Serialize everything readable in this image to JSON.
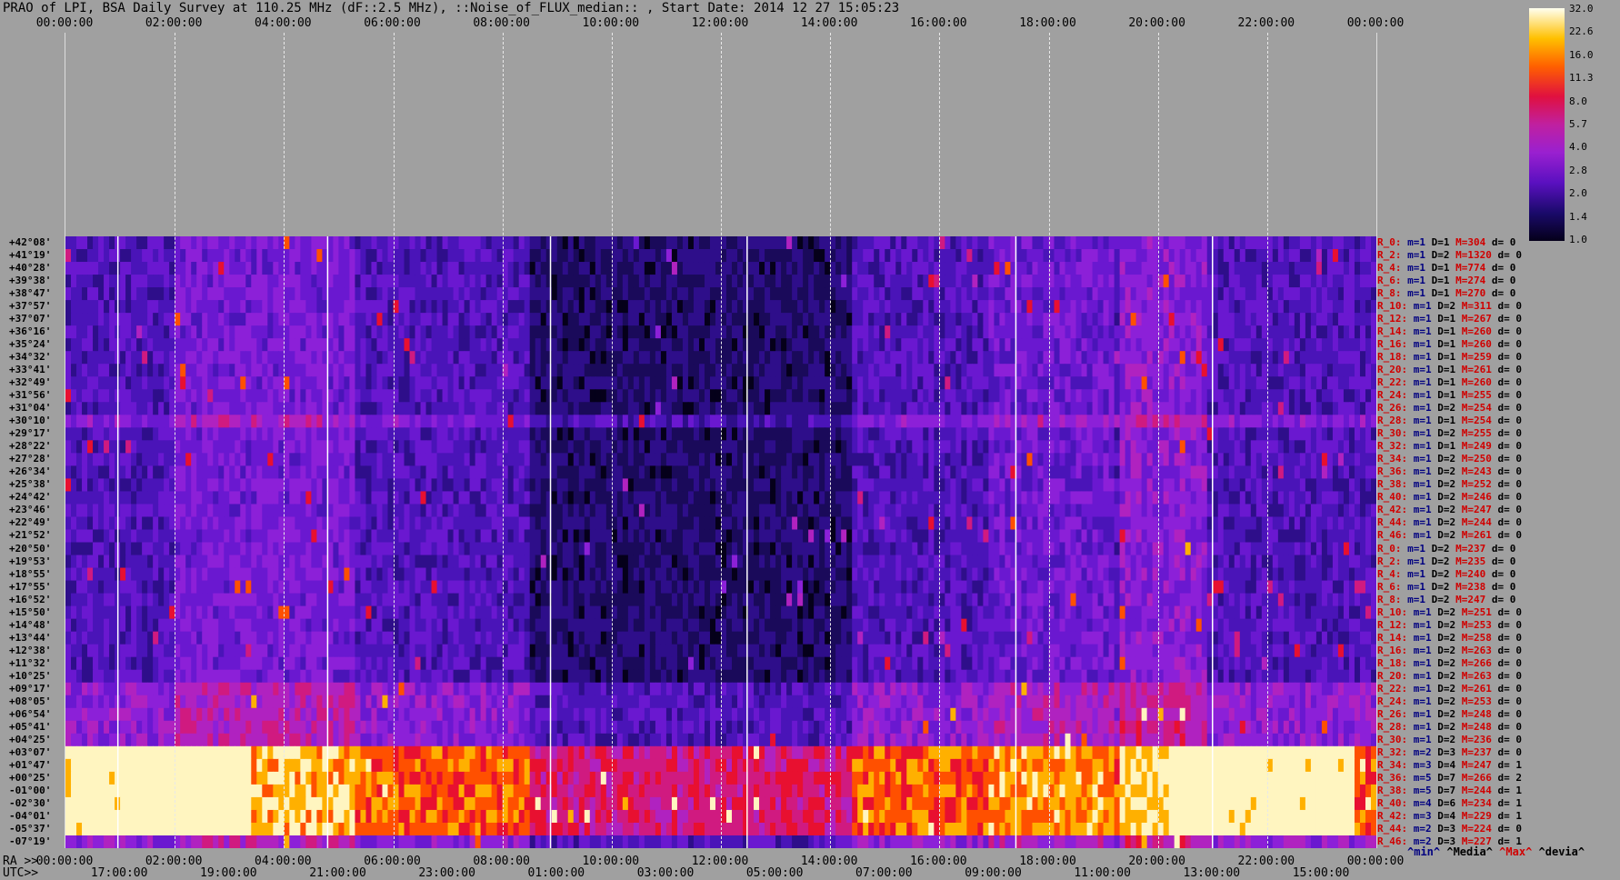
{
  "title": "PRAO of LPI, BSA Daily Survey at 110.25 MHz (dF::2.5 MHz), ::Noise_of_FLUX_median:: , Start Date: 2014 12 27 15:05:23",
  "top_ticks": [
    "00:00:00",
    "02:00:00",
    "04:00:00",
    "06:00:00",
    "08:00:00",
    "10:00:00",
    "12:00:00",
    "14:00:00",
    "16:00:00",
    "18:00:00",
    "20:00:00",
    "22:00:00",
    "00:00:00"
  ],
  "bottom_ra_prefix": "RA >>",
  "bottom_ra_ticks": [
    "00:00:00",
    "02:00:00",
    "04:00:00",
    "06:00:00",
    "08:00:00",
    "10:00:00",
    "12:00:00",
    "14:00:00",
    "16:00:00",
    "18:00:00",
    "20:00:00",
    "22:00:00",
    "00:00:00"
  ],
  "bottom_utc_prefix": "UTC>>",
  "bottom_utc_ticks": [
    "17:00:00",
    "19:00:00",
    "21:00:00",
    "23:00:00",
    "01:00:00",
    "03:00:00",
    "05:00:00",
    "07:00:00",
    "09:00:00",
    "11:00:00",
    "13:00:00",
    "15:00:00"
  ],
  "colorbar": {
    "labels": [
      "32.0",
      "22.6",
      "16.0",
      "11.3",
      "8.0",
      "5.7",
      "4.0",
      "2.8",
      "2.0",
      "1.4",
      "1.0"
    ]
  },
  "legend": {
    "min": "^min^",
    "median": "^Media^",
    "max": "^Max^",
    "devia": "^devia^"
  },
  "declinations": [
    "+42°08'",
    "+41°19'",
    "+40°28'",
    "+39°38'",
    "+38°47'",
    "+37°57'",
    "+37°07'",
    "+36°16'",
    "+35°24'",
    "+34°32'",
    "+33°41'",
    "+32°49'",
    "+31°56'",
    "+31°04'",
    "+30°10'",
    "+29°17'",
    "+28°22'",
    "+27°28'",
    "+26°34'",
    "+25°38'",
    "+24°42'",
    "+23°46'",
    "+22°49'",
    "+21°52'",
    "+20°50'",
    "+19°53'",
    "+18°55'",
    "+17°55'",
    "+16°52'",
    "+15°50'",
    "+14°48'",
    "+13°44'",
    "+12°38'",
    "+11°32'",
    "+10°25'",
    "+09°17'",
    "+08°05'",
    "+06°54'",
    "+05°41'",
    "+04°25'",
    "+03°07'",
    "+01°47'",
    "+00°25'",
    "-01°00'",
    "-02°30'",
    "-04°01'",
    "-05°37'",
    "-07°19'"
  ],
  "stats": [
    {
      "r": "R_0:",
      "m": "m=1",
      "d": "D=1",
      "M": "M=304",
      "dv": "d= 0"
    },
    {
      "r": "R_2:",
      "m": "m=1",
      "d": "D=2",
      "M": "M=1320",
      "dv": "d= 0"
    },
    {
      "r": "R_4:",
      "m": "m=1",
      "d": "D=1",
      "M": "M=774",
      "dv": "d= 0"
    },
    {
      "r": "R_6:",
      "m": "m=1",
      "d": "D=1",
      "M": "M=274",
      "dv": "d= 0"
    },
    {
      "r": "R_8:",
      "m": "m=1",
      "d": "D=1",
      "M": "M=270",
      "dv": "d= 0"
    },
    {
      "r": "R_10:",
      "m": "m=1",
      "d": "D=2",
      "M": "M=311",
      "dv": "d= 0"
    },
    {
      "r": "R_12:",
      "m": "m=1",
      "d": "D=1",
      "M": "M=267",
      "dv": "d= 0"
    },
    {
      "r": "R_14:",
      "m": "m=1",
      "d": "D=1",
      "M": "M=260",
      "dv": "d= 0"
    },
    {
      "r": "R_16:",
      "m": "m=1",
      "d": "D=1",
      "M": "M=260",
      "dv": "d= 0"
    },
    {
      "r": "R_18:",
      "m": "m=1",
      "d": "D=1",
      "M": "M=259",
      "dv": "d= 0"
    },
    {
      "r": "R_20:",
      "m": "m=1",
      "d": "D=1",
      "M": "M=261",
      "dv": "d= 0"
    },
    {
      "r": "R_22:",
      "m": "m=1",
      "d": "D=1",
      "M": "M=260",
      "dv": "d= 0"
    },
    {
      "r": "R_24:",
      "m": "m=1",
      "d": "D=1",
      "M": "M=255",
      "dv": "d= 0"
    },
    {
      "r": "R_26:",
      "m": "m=1",
      "d": "D=2",
      "M": "M=254",
      "dv": "d= 0"
    },
    {
      "r": "R_28:",
      "m": "m=1",
      "d": "D=1",
      "M": "M=254",
      "dv": "d= 0"
    },
    {
      "r": "R_30:",
      "m": "m=1",
      "d": "D=2",
      "M": "M=255",
      "dv": "d= 0"
    },
    {
      "r": "R_32:",
      "m": "m=1",
      "d": "D=1",
      "M": "M=249",
      "dv": "d= 0"
    },
    {
      "r": "R_34:",
      "m": "m=1",
      "d": "D=2",
      "M": "M=250",
      "dv": "d= 0"
    },
    {
      "r": "R_36:",
      "m": "m=1",
      "d": "D=2",
      "M": "M=243",
      "dv": "d= 0"
    },
    {
      "r": "R_38:",
      "m": "m=1",
      "d": "D=2",
      "M": "M=252",
      "dv": "d= 0"
    },
    {
      "r": "R_40:",
      "m": "m=1",
      "d": "D=2",
      "M": "M=246",
      "dv": "d= 0"
    },
    {
      "r": "R_42:",
      "m": "m=1",
      "d": "D=2",
      "M": "M=247",
      "dv": "d= 0"
    },
    {
      "r": "R_44:",
      "m": "m=1",
      "d": "D=2",
      "M": "M=244",
      "dv": "d= 0"
    },
    {
      "r": "R_46:",
      "m": "m=1",
      "d": "D=2",
      "M": "M=261",
      "dv": "d= 0"
    },
    {
      "r": "R_0:",
      "m": "m=1",
      "d": "D=2",
      "M": "M=237",
      "dv": "d= 0"
    },
    {
      "r": "R_2:",
      "m": "m=1",
      "d": "D=2",
      "M": "M=235",
      "dv": "d= 0"
    },
    {
      "r": "R_4:",
      "m": "m=1",
      "d": "D=2",
      "M": "M=240",
      "dv": "d= 0"
    },
    {
      "r": "R_6:",
      "m": "m=1",
      "d": "D=2",
      "M": "M=238",
      "dv": "d= 0"
    },
    {
      "r": "R_8:",
      "m": "m=1",
      "d": "D=2",
      "M": "M=247",
      "dv": "d= 0"
    },
    {
      "r": "R_10:",
      "m": "m=1",
      "d": "D=2",
      "M": "M=251",
      "dv": "d= 0"
    },
    {
      "r": "R_12:",
      "m": "m=1",
      "d": "D=2",
      "M": "M=253",
      "dv": "d= 0"
    },
    {
      "r": "R_14:",
      "m": "m=1",
      "d": "D=2",
      "M": "M=258",
      "dv": "d= 0"
    },
    {
      "r": "R_16:",
      "m": "m=1",
      "d": "D=2",
      "M": "M=263",
      "dv": "d= 0"
    },
    {
      "r": "R_18:",
      "m": "m=1",
      "d": "D=2",
      "M": "M=266",
      "dv": "d= 0"
    },
    {
      "r": "R_20:",
      "m": "m=1",
      "d": "D=2",
      "M": "M=263",
      "dv": "d= 0"
    },
    {
      "r": "R_22:",
      "m": "m=1",
      "d": "D=2",
      "M": "M=261",
      "dv": "d= 0"
    },
    {
      "r": "R_24:",
      "m": "m=1",
      "d": "D=2",
      "M": "M=253",
      "dv": "d= 0"
    },
    {
      "r": "R_26:",
      "m": "m=1",
      "d": "D=2",
      "M": "M=248",
      "dv": "d= 0"
    },
    {
      "r": "R_28:",
      "m": "m=1",
      "d": "D=2",
      "M": "M=248",
      "dv": "d= 0"
    },
    {
      "r": "R_30:",
      "m": "m=1",
      "d": "D=2",
      "M": "M=236",
      "dv": "d= 0"
    },
    {
      "r": "R_32:",
      "m": "m=2",
      "d": "D=3",
      "M": "M=237",
      "dv": "d= 0"
    },
    {
      "r": "R_34:",
      "m": "m=3",
      "d": "D=4",
      "M": "M=247",
      "dv": "d= 1"
    },
    {
      "r": "R_36:",
      "m": "m=5",
      "d": "D=7",
      "M": "M=266",
      "dv": "d= 2"
    },
    {
      "r": "R_38:",
      "m": "m=5",
      "d": "D=7",
      "M": "M=244",
      "dv": "d= 1"
    },
    {
      "r": "R_40:",
      "m": "m=4",
      "d": "D=6",
      "M": "M=234",
      "dv": "d= 1"
    },
    {
      "r": "R_42:",
      "m": "m=3",
      "d": "D=4",
      "M": "M=229",
      "dv": "d= 1"
    },
    {
      "r": "R_44:",
      "m": "m=2",
      "d": "D=3",
      "M": "M=224",
      "dv": "d= 0"
    },
    {
      "r": "R_46:",
      "m": "m=2",
      "d": "D=3",
      "M": "M=227",
      "dv": "d= 1"
    }
  ]
}
